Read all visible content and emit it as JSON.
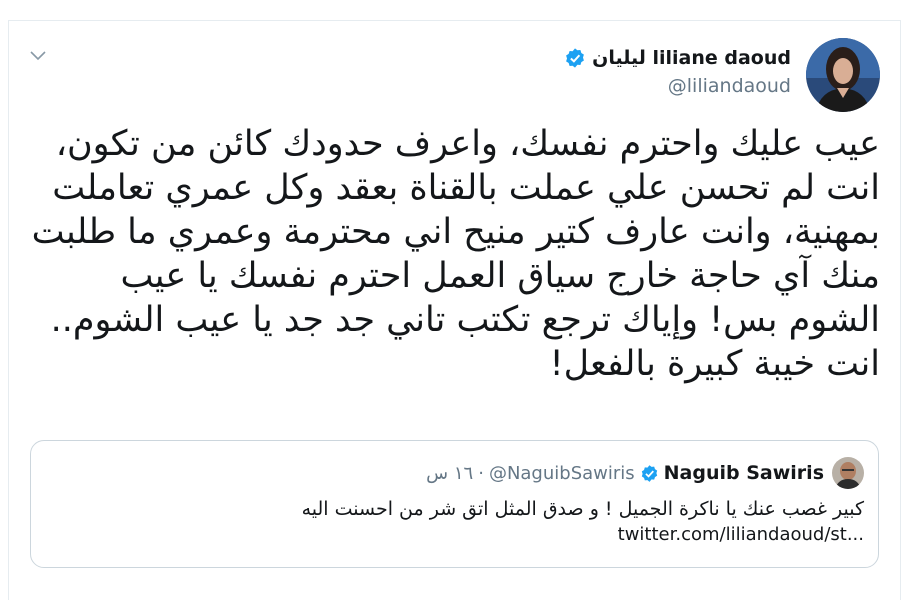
{
  "author": {
    "name": "ليليان liliane daoud",
    "handle": "@liliandaoud",
    "verified": true
  },
  "tweet": {
    "text": "عيب عليك واحترم نفسك، واعرف حدودك كائن من تكون، انت لم تحسن علي عملت بالقناة بعقد وكل عمري تعاملت بمهنية، وانت عارف كتير منيح اني محترمة وعمري ما طلبت منك آي حاجة خارج سياق العمل احترم نفسك يا عيب الشوم بس! وإياك ترجع تكتب تاني جد جد يا عيب الشوم.. انت خيبة كبيرة بالفعل!"
  },
  "quoted_tweet": {
    "name": "Naguib Sawiris",
    "handle": "@NaguibSawiris",
    "separator": "·",
    "time": "١٦ س",
    "text": "كبير غصب عنك يا ناكرة الجميل ! و صدق المثل اتق شر من احسنت اليه",
    "link": "twitter.com/liliandaoud/st..."
  },
  "colors": {
    "verified_blue": "#1da1f2",
    "secondary_text": "#657786",
    "border": "#ccd6dd"
  },
  "icons": {
    "menu": "chevron-down-icon",
    "verified": "verified-badge-icon"
  }
}
